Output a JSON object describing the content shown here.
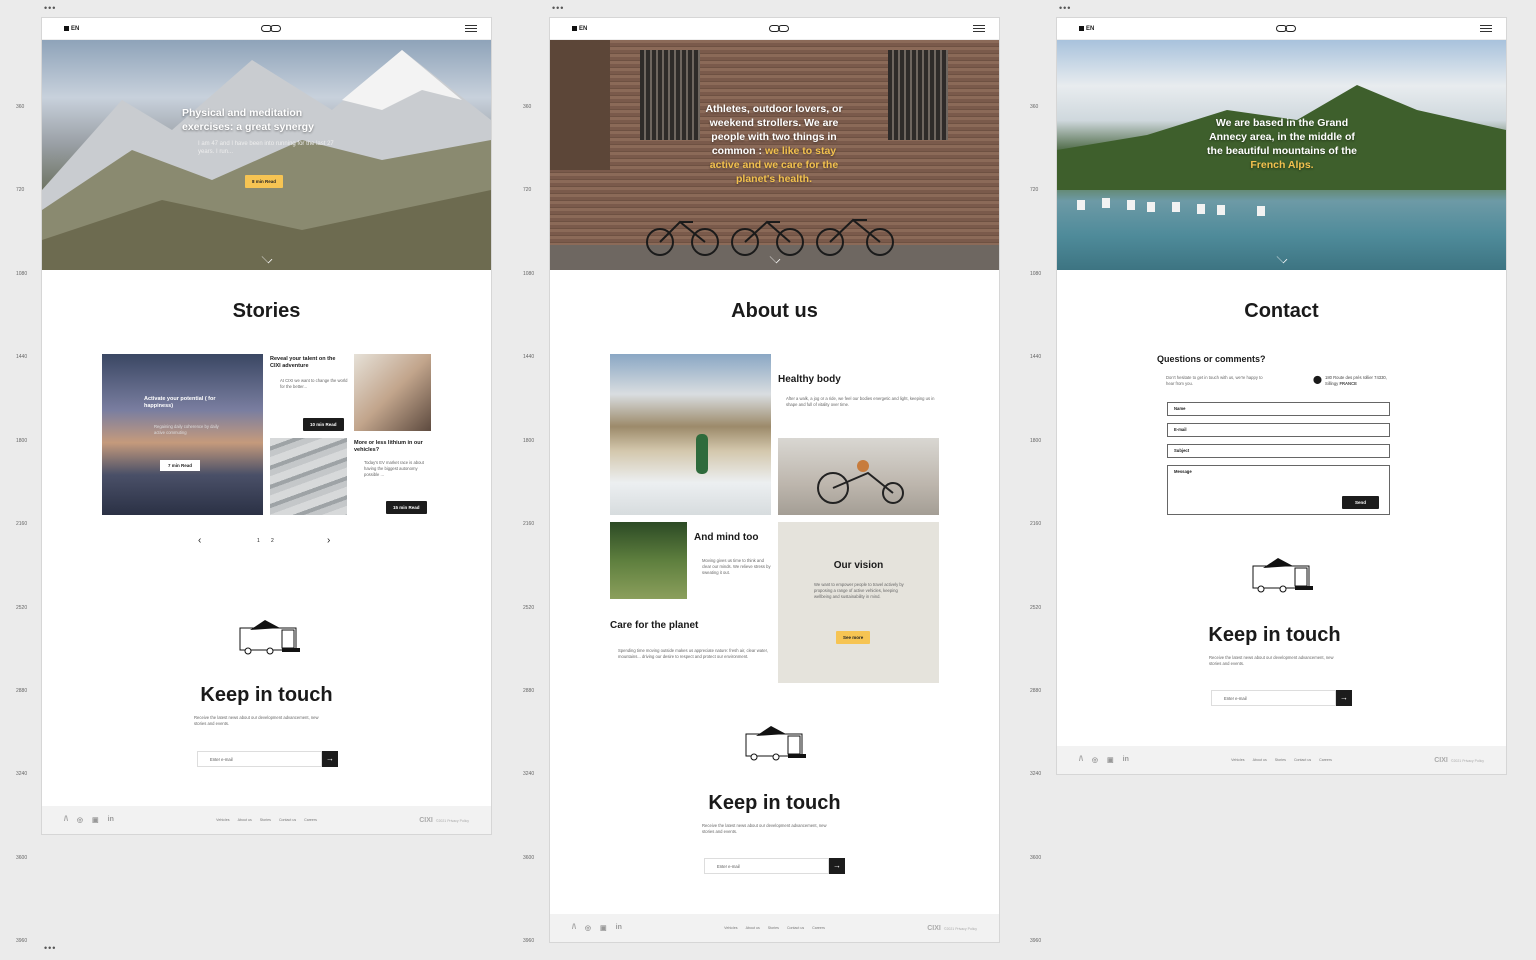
{
  "rulers": [
    "360",
    "720",
    "1080",
    "1440",
    "1800",
    "2160",
    "2520",
    "2880",
    "3240",
    "3600",
    "3960"
  ],
  "lang": "EN",
  "footer": {
    "social": [
      "/\\",
      "◎",
      "▣",
      "in"
    ],
    "links": [
      "Vehicles",
      "About us",
      "Stories",
      "Contact us",
      "Careers"
    ],
    "brand": "CIXI",
    "legal": "©2021  Privacy Policy"
  },
  "stories": {
    "hero_title": "Physical and meditation exercises: a great synergy",
    "hero_text": "I am 47 and I have been into running for the last 27 years. I run...",
    "hero_btn": "8 min Read",
    "title": "Stories",
    "card1": {
      "title": "Activate your potential ( for happiness)",
      "text": "Regaining daily coherence by daily active commuting",
      "btn": "7 min Read"
    },
    "card2": {
      "title": "Reveal your talent on the CIXI adventure",
      "text": "At CIXI we want to change the world for the better...",
      "btn": "10 min Read"
    },
    "card3": {
      "title": "More or less lithium in our vehicles?",
      "text": "Today's EV market race is about having the biggest autonomy possible ...",
      "btn": "15 min Read"
    },
    "pages": [
      "1",
      "2"
    ],
    "keep_title": "Keep in touch",
    "keep_text": "Receive the latest news about our development advancement, new stories and events.",
    "email_ph": "Enter e-mail"
  },
  "about": {
    "hero_pre": "Athletes, outdoor lovers, or weekend strollers. We are people with two things in common :",
    "hero_hl": "we like to stay active and we care for the planet's health.",
    "title": "About us",
    "healthy_title": "Healthy body",
    "healthy_text": "After a walk, a jog or a ride, we feel our bodies energetic and light, keeping us in shape and full of vitality over time.",
    "mind_title": "And mind too",
    "mind_text": "Moving gives us time to think and clear our minds. We relieve stress by sweating it out.",
    "planet_title": "Care for the planet",
    "planet_text": "Spending time moving outside makes us appreciate nature: fresh air, clear water, mountains... driving our desire to respect and protect our environment.",
    "vision_title": "Our vision",
    "vision_text": "We want to empower people to travel actively by proposing a range of active vehicles, keeping wellbeing and sustainability in mind.",
    "vision_btn": "See more",
    "keep_title": "Keep in touch",
    "keep_text": "Receive the latest news about our development advancement, new stories and events.",
    "email_ph": "Enter e-mail"
  },
  "contact": {
    "hero_pre": "We are based in the Grand Annecy area, in the middle of the beautiful mountains of the",
    "hero_hl": "French Alps.",
    "title": "Contact",
    "q_title": "Questions or comments?",
    "q_text": "Don't hesitate to get in touch with us, we're happy to hear from you.",
    "address": "180 Route des prés rollier 74330, Sillingy",
    "country": "FRANCE",
    "fields": {
      "name": "Name",
      "email": "E-mail",
      "subject": "Subject",
      "message": "Message"
    },
    "send": "Send",
    "keep_title": "Keep in touch",
    "keep_text": "Receive the latest news about our development advancement, new stories and events.",
    "email_ph": "Enter e-mail"
  }
}
